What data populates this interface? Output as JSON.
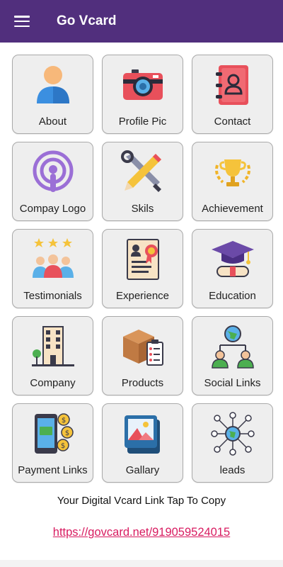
{
  "app": {
    "title": "Go Vcard",
    "menu_icon": "hamburger-menu-icon",
    "brand_color": "#512f7d"
  },
  "tiles": [
    {
      "label": "About",
      "icon": "person-icon"
    },
    {
      "label": "Profile Pic",
      "icon": "camera-icon"
    },
    {
      "label": "Contact",
      "icon": "address-book-icon"
    },
    {
      "label": "Compay Logo",
      "icon": "podcast-logo-icon"
    },
    {
      "label": "Skils",
      "icon": "tools-icon"
    },
    {
      "label": "Achievement",
      "icon": "trophy-icon"
    },
    {
      "label": "Testimonials",
      "icon": "rated-people-icon"
    },
    {
      "label": "Experience",
      "icon": "certificate-icon"
    },
    {
      "label": "Education",
      "icon": "graduation-cap-icon"
    },
    {
      "label": "Company",
      "icon": "building-icon"
    },
    {
      "label": "Products",
      "icon": "box-checklist-icon"
    },
    {
      "label": "Social Links",
      "icon": "network-people-icon"
    },
    {
      "label": "Payment Links",
      "icon": "mobile-payment-icon"
    },
    {
      "label": "Gallary",
      "icon": "gallery-icon"
    },
    {
      "label": "leads",
      "icon": "globe-network-icon"
    }
  ],
  "footer": {
    "copy_text": "Your Digital Vcard Link Tap To Copy",
    "link": "https://govcard.net/919059524015",
    "link_color": "#d81b60"
  }
}
